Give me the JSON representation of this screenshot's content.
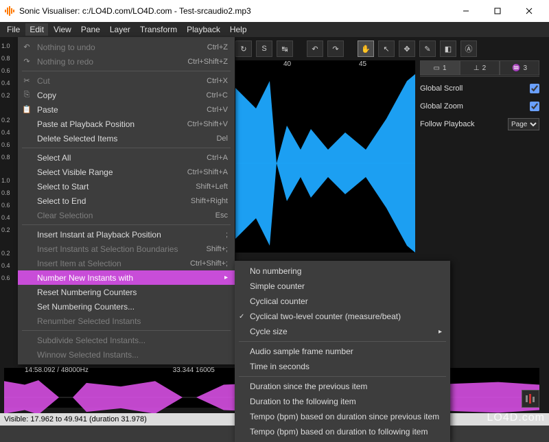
{
  "window": {
    "title": "Sonic Visualiser: c:/LO4D.com/LO4D.com - Test-srcaudio2.mp3"
  },
  "menubar": [
    "File",
    "Edit",
    "View",
    "Pane",
    "Layer",
    "Transform",
    "Playback",
    "Help"
  ],
  "edit_menu": {
    "groups": [
      [
        {
          "label": "Nothing to undo",
          "shortcut": "Ctrl+Z",
          "enabled": false,
          "icon": "↶"
        },
        {
          "label": "Nothing to redo",
          "shortcut": "Ctrl+Shift+Z",
          "enabled": false,
          "icon": "↷"
        }
      ],
      [
        {
          "label": "Cut",
          "shortcut": "Ctrl+X",
          "enabled": false,
          "icon": "✂"
        },
        {
          "label": "Copy",
          "shortcut": "Ctrl+C",
          "enabled": true,
          "icon": "⎘"
        },
        {
          "label": "Paste",
          "shortcut": "Ctrl+V",
          "enabled": true,
          "icon": "📋"
        },
        {
          "label": "Paste at Playback Position",
          "shortcut": "Ctrl+Shift+V",
          "enabled": true
        },
        {
          "label": "Delete Selected Items",
          "shortcut": "Del",
          "enabled": true
        }
      ],
      [
        {
          "label": "Select All",
          "shortcut": "Ctrl+A",
          "enabled": true
        },
        {
          "label": "Select Visible Range",
          "shortcut": "Ctrl+Shift+A",
          "enabled": true
        },
        {
          "label": "Select to Start",
          "shortcut": "Shift+Left",
          "enabled": true
        },
        {
          "label": "Select to End",
          "shortcut": "Shift+Right",
          "enabled": true
        },
        {
          "label": "Clear Selection",
          "shortcut": "Esc",
          "enabled": false
        }
      ],
      [
        {
          "label": "Insert Instant at Playback Position",
          "shortcut": ";",
          "enabled": true
        },
        {
          "label": "Insert Instants at Selection Boundaries",
          "shortcut": "Shift+;",
          "enabled": false
        },
        {
          "label": "Insert Item at Selection",
          "shortcut": "Ctrl+Shift+;",
          "enabled": false
        },
        {
          "label": "Number New Instants with",
          "submenu": true,
          "highlight": true
        },
        {
          "label": "Reset Numbering Counters",
          "enabled": true
        },
        {
          "label": "Set Numbering Counters...",
          "enabled": true
        },
        {
          "label": "Renumber Selected Instants",
          "enabled": false
        }
      ],
      [
        {
          "label": "Subdivide Selected Instants...",
          "enabled": false
        },
        {
          "label": "Winnow Selected Instants...",
          "enabled": false
        }
      ]
    ]
  },
  "submenu": {
    "groups": [
      [
        {
          "label": "No numbering"
        },
        {
          "label": "Simple counter"
        },
        {
          "label": "Cyclical counter"
        },
        {
          "label": "Cyclical two-level counter (measure/beat)",
          "checked": true
        },
        {
          "label": "Cycle size",
          "submenu": true
        }
      ],
      [
        {
          "label": "Audio sample frame number"
        },
        {
          "label": "Time in seconds"
        }
      ],
      [
        {
          "label": "Duration since the previous item"
        },
        {
          "label": "Duration to the following item"
        },
        {
          "label": "Tempo (bpm) based on duration since previous item"
        },
        {
          "label": "Tempo (bpm) based on duration to following item"
        }
      ]
    ]
  },
  "scale_ticks": [
    "1.0",
    "0.8",
    "0.6",
    "0.4",
    "0.2",
    "0.2",
    "0.4",
    "0.6",
    "0.8",
    "1.0",
    "0.8",
    "0.6",
    "0.4",
    "0.2",
    "0.2",
    "0.4",
    "0.6"
  ],
  "time_labels": {
    "a": "40",
    "b": "45"
  },
  "layer_tabs": {
    "t1": "1",
    "t2": "2",
    "t3": "3"
  },
  "props": {
    "global_scroll": {
      "label": "Global Scroll",
      "checked": true
    },
    "global_zoom": {
      "label": "Global Zoom",
      "checked": true
    },
    "follow": {
      "label": "Follow Playback",
      "value": "Page"
    }
  },
  "overview": {
    "time": "14:58.092 / 48000Hz",
    "right": "33.344  16005"
  },
  "status": "Visible: 17.962 to 49.941 (duration 31.978)",
  "watermark": "LO4D.com"
}
